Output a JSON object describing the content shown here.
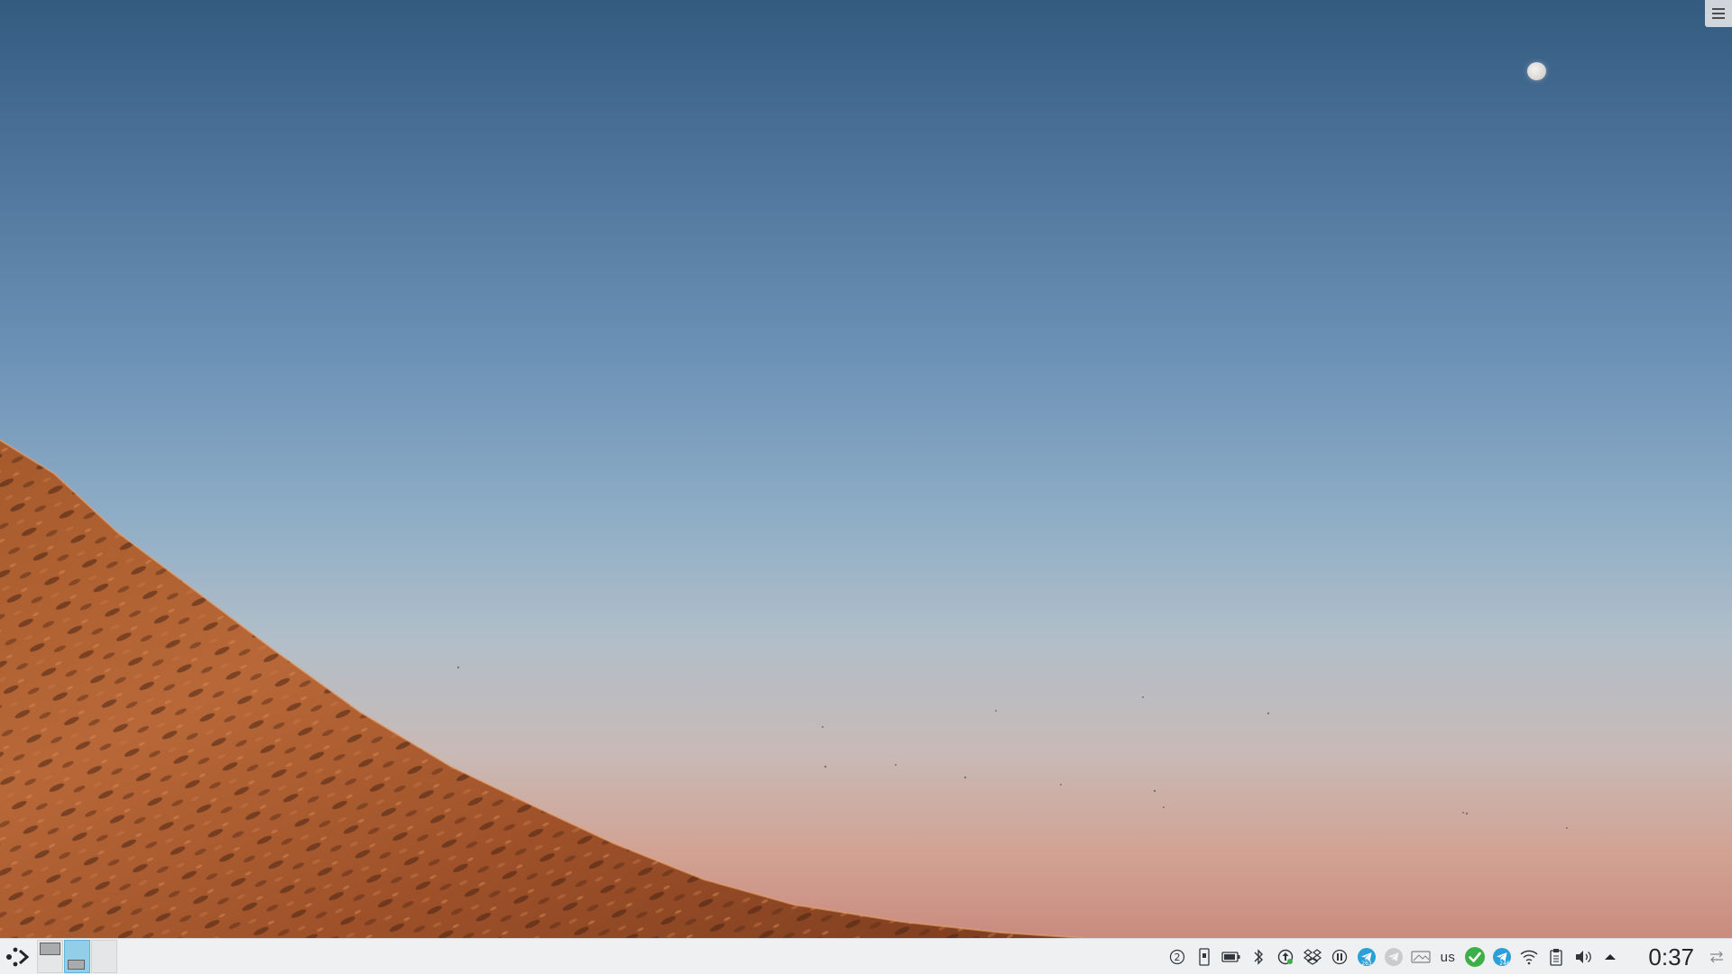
{
  "wallpaper": {
    "description_icon": "sunset-hillside-wallpaper"
  },
  "desktop_toolbox": {
    "icon": "hamburger-menu-icon"
  },
  "panel": {
    "launcher_icon": "application-launcher-icon",
    "pager": {
      "desktops": [
        {
          "active": false
        },
        {
          "active": true
        },
        {
          "active": false
        }
      ]
    },
    "tray": {
      "items": [
        {
          "icon": "help-circle-icon",
          "label": "2"
        },
        {
          "icon": "device-notifier-icon"
        },
        {
          "icon": "battery-icon"
        },
        {
          "icon": "bluetooth-icon"
        },
        {
          "icon": "update-notifier-icon"
        },
        {
          "icon": "dropbox-icon"
        },
        {
          "icon": "media-pause-icon"
        },
        {
          "icon": "telegram-icon",
          "label": "263"
        },
        {
          "icon": "telegram-inactive-icon"
        },
        {
          "icon": "display-icon"
        },
        {
          "icon": "keyboard-layout-indicator",
          "label": "us"
        },
        {
          "icon": "sync-ok-icon"
        },
        {
          "icon": "telegram-icon",
          "label": "246"
        },
        {
          "icon": "wifi-icon"
        },
        {
          "icon": "clipboard-icon"
        },
        {
          "icon": "volume-icon"
        },
        {
          "icon": "show-hidden-icons-arrow"
        }
      ],
      "keyboard_layout": "us"
    },
    "clock": {
      "time": "0:37"
    },
    "options_icon": "panel-options-icon"
  },
  "colors": {
    "panel_bg": "#eff0f1",
    "active_desktop": "#93cee9",
    "accent_green": "#3daf47",
    "telegram_blue": "#2a9fd8"
  }
}
